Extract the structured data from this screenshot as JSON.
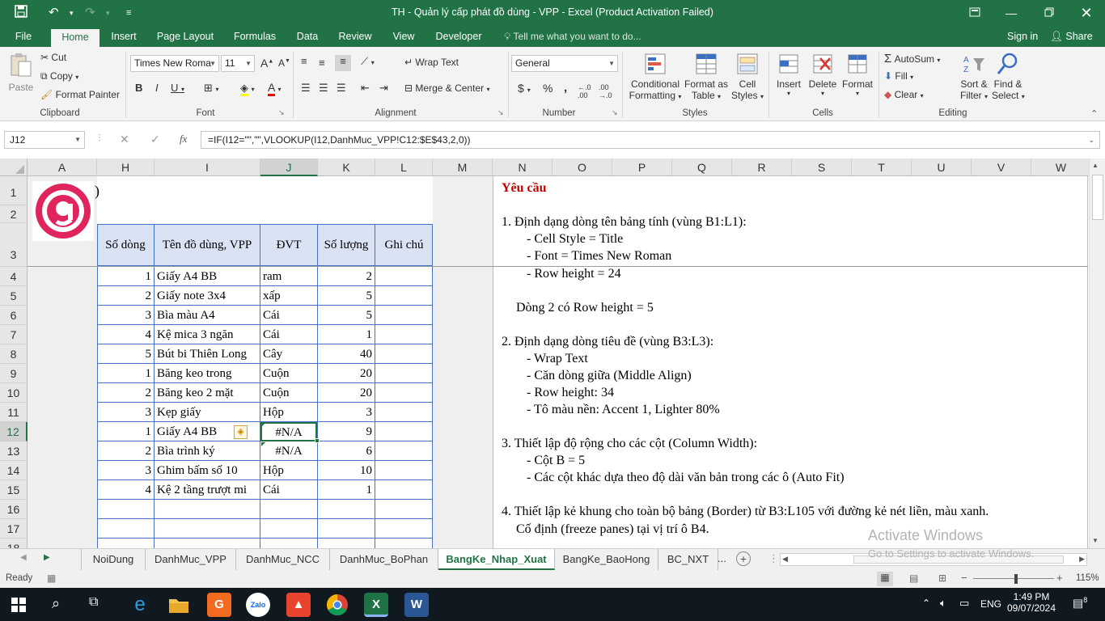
{
  "app": {
    "title": "TH - Quản lý cấp phát đồ dùng - VPP - Excel (Product Activation Failed)"
  },
  "ribbon_tabs": [
    "File",
    "Home",
    "Insert",
    "Page Layout",
    "Formulas",
    "Data",
    "Review",
    "View",
    "Developer"
  ],
  "tell_me": "Tell me what you want to do...",
  "sign_in": "Sign in",
  "share": "Share",
  "clipboard": {
    "paste": "Paste",
    "cut": "Cut",
    "copy": "Copy",
    "format_painter": "Format Painter",
    "label": "Clipboard"
  },
  "font": {
    "name": "Times New Roma",
    "size": "11",
    "label": "Font"
  },
  "alignment": {
    "wrap_text": "Wrap Text",
    "merge_center": "Merge & Center",
    "label": "Alignment"
  },
  "number": {
    "format": "General",
    "label": "Number"
  },
  "styles": {
    "conditional_1": "Conditional",
    "conditional_2": "Formatting",
    "format_as_1": "Format as",
    "format_as_2": "Table",
    "cell_styles_1": "Cell",
    "cell_styles_2": "Styles",
    "label": "Styles"
  },
  "cells": {
    "insert": "Insert",
    "delete": "Delete",
    "format": "Format",
    "label": "Cells"
  },
  "editing": {
    "autosum": "AutoSum",
    "fill": "Fill",
    "clear": "Clear",
    "sort_1": "Sort &",
    "sort_2": "Filter",
    "find_1": "Find &",
    "find_2": "Select",
    "label": "Editing"
  },
  "formula_bar": {
    "name_box": "J12",
    "formula": "=IF(I12=\"\",\"\",VLOOKUP(I12,DanhMuc_VPP!C12:$E$43,2,0))"
  },
  "columns": [
    "A",
    "H",
    "I",
    "J",
    "K",
    "L",
    "M",
    "N",
    "O",
    "P",
    "Q",
    "R",
    "S",
    "T",
    "U",
    "V",
    "W"
  ],
  "rows": [
    "1",
    "2",
    "3",
    "4",
    "5",
    "6",
    "7",
    "8",
    "9",
    "10",
    "11",
    "12",
    "13",
    "14",
    "15",
    "16",
    "17",
    "18"
  ],
  "title_fragment": ")",
  "table": {
    "headers": [
      "Số dòng",
      "Tên đồ dùng, VPP",
      "ĐVT",
      "Số lượng",
      "Ghi chú"
    ],
    "rows": [
      [
        "1",
        "Giấy A4 BB",
        "ram",
        "2",
        ""
      ],
      [
        "2",
        "Giấy note 3x4",
        "xấp",
        "5",
        ""
      ],
      [
        "3",
        "Bìa màu A4",
        "Cái",
        "5",
        ""
      ],
      [
        "4",
        "Kệ mica 3 ngăn",
        "Cái",
        "1",
        ""
      ],
      [
        "5",
        "Bút bi Thiên Long",
        "Cây",
        "40",
        ""
      ],
      [
        "1",
        "Băng keo trong",
        "Cuộn",
        "20",
        ""
      ],
      [
        "2",
        "Băng keo 2 mặt",
        "Cuộn",
        "20",
        ""
      ],
      [
        "3",
        "Kẹp giấy",
        "Hộp",
        "3",
        ""
      ],
      [
        "1",
        "Giấy A4 BB",
        "#N/A",
        "9",
        ""
      ],
      [
        "2",
        "Bìa trình ký",
        "#N/A",
        "6",
        ""
      ],
      [
        "3",
        "Ghim bấm số 10",
        "Hộp",
        "10",
        ""
      ],
      [
        "4",
        "Kệ 2 tầng trượt mi",
        "Cái",
        "1",
        ""
      ]
    ]
  },
  "requirements": {
    "title": "Yêu cầu",
    "lines": [
      "1. Định dạng dòng tên bảng tính (vùng B1:L1):",
      "- Cell Style = Title",
      "- Font = Times New Roman",
      "- Row height = 24",
      "Dòng 2 có Row height = 5",
      "2. Định dạng dòng tiêu đề (vùng B3:L3):",
      "- Wrap Text",
      "- Căn dòng giữa (Middle Align)",
      "- Row height: 34",
      "- Tô màu nền: Accent 1, Lighter 80%",
      "3. Thiết lập độ rộng cho các cột (Column Width):",
      "- Cột B = 5",
      "- Các cột khác dựa theo độ dài văn bản trong các ô (Auto Fit)",
      "4. Thiết lập kẻ khung cho toàn bộ bảng (Border) từ B3:L105 với đường kẻ nét liền, màu xanh.",
      "Cố định (freeze panes) tại vị trí ô B4."
    ]
  },
  "watermark": {
    "line1": "Activate Windows",
    "line2": "Go to Settings to activate Windows."
  },
  "sheet_tabs": [
    "NoiDung",
    "DanhMuc_VPP",
    "DanhMuc_NCC",
    "DanhMuc_BoPhan",
    "BangKe_Nhap_Xuat",
    "BangKe_BaoHong",
    "BC_NXT"
  ],
  "sheet_more": "...",
  "status": {
    "ready": "Ready",
    "zoom": "115%"
  },
  "taskbar": {
    "lang": "ENG",
    "time": "1:49 PM",
    "date": "09/07/2024",
    "notifications": "8"
  },
  "colors": {
    "excel_green": "#217346",
    "header_fill": "#dae3f3",
    "table_border": "#4472c4",
    "req_title": "#c00000"
  }
}
